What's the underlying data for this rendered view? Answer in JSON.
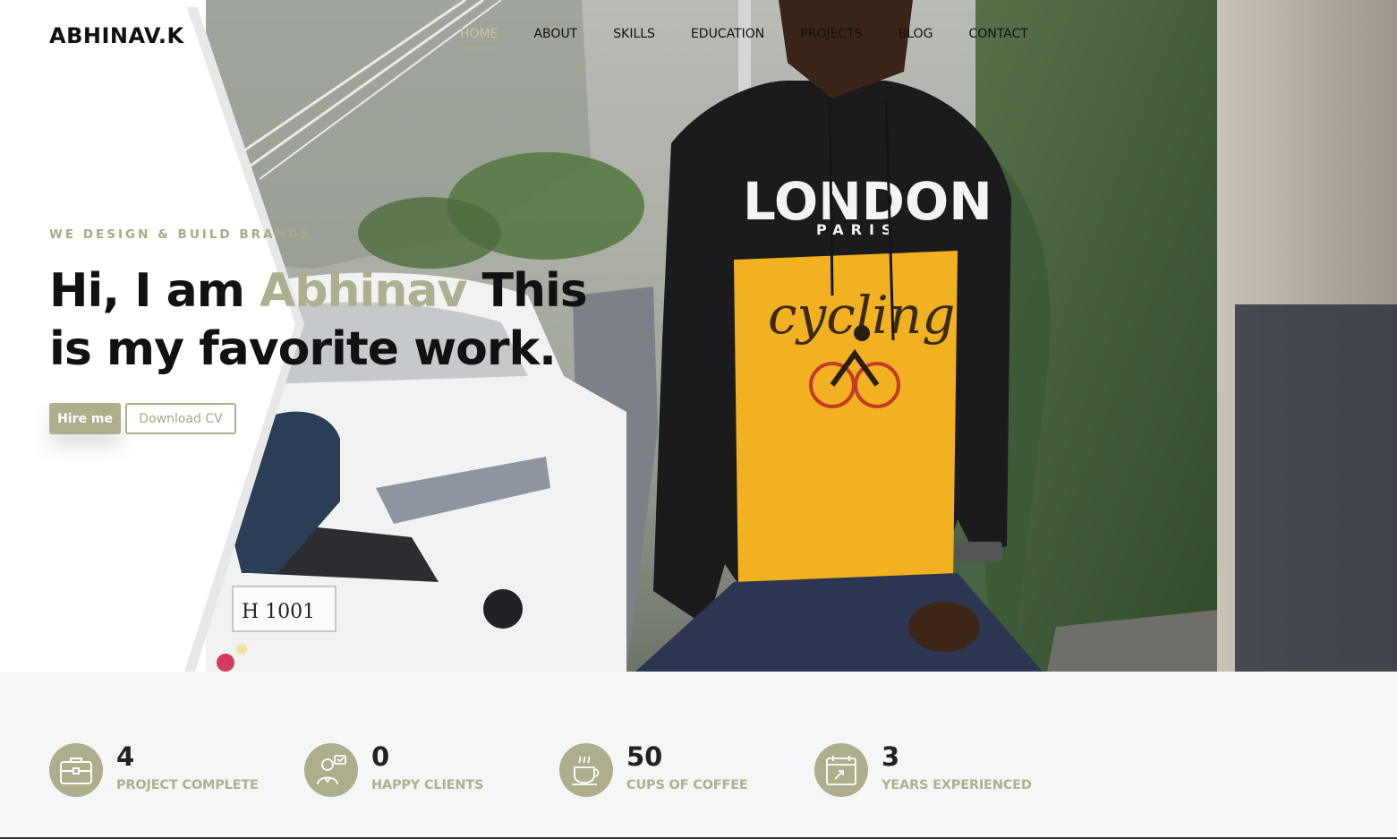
{
  "brand": {
    "logo": "ABHINAV.K"
  },
  "nav": {
    "items": [
      {
        "label": "HOME",
        "active": true
      },
      {
        "label": "ABOUT"
      },
      {
        "label": "SKILLS"
      },
      {
        "label": "EDUCATION"
      },
      {
        "label": "PROJECTS"
      },
      {
        "label": "BLOG"
      },
      {
        "label": "CONTACT"
      }
    ]
  },
  "hero": {
    "tagline": "WE DESIGN & BUILD BRANDS",
    "headline_prefix": "Hi, I am",
    "headline_name": "Abhinav",
    "headline_suffix": "This is my favorite work.",
    "hire_label": "Hire me",
    "cv_label": "Download CV",
    "photo_shirt_text": "LONDON",
    "photo_shirt_sub": "PARIS",
    "photo_shirt_script": "cycling",
    "photo_plate": "H 1001"
  },
  "stats": [
    {
      "value": "4",
      "label": "PROJECT COMPLETE",
      "icon": "briefcase-icon"
    },
    {
      "value": "0",
      "label": "HAPPY CLIENTS",
      "icon": "client-icon"
    },
    {
      "value": "50",
      "label": "CUPS OF COFFEE",
      "icon": "coffee-cup-icon"
    },
    {
      "value": "3",
      "label": "YEARS EXPERIENCED",
      "icon": "calendar-icon"
    }
  ],
  "colors": {
    "accent": "#aeae8c",
    "accent_text": "#a9a987",
    "dark": "#111111",
    "stats_bg": "#f5f6f8"
  }
}
